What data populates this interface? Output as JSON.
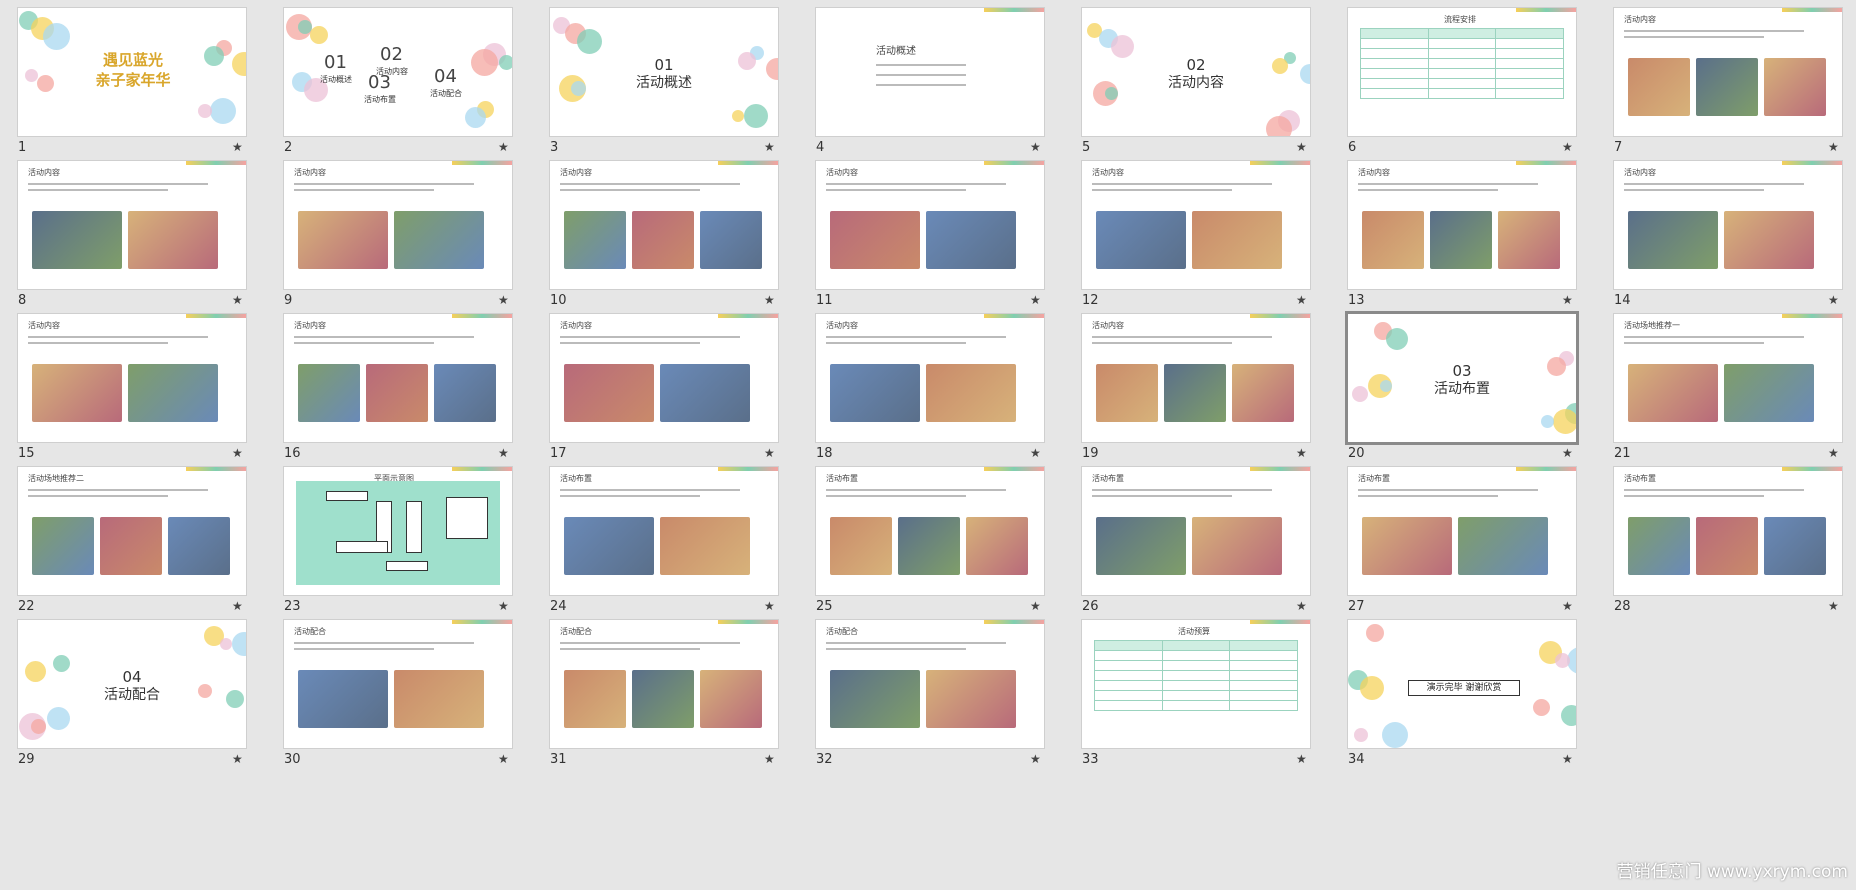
{
  "slides": [
    {
      "num": "1",
      "title": "遇见蓝光\n亲子家年华",
      "kind": "cover"
    },
    {
      "num": "2",
      "kind": "menu",
      "items": [
        {
          "n": "01",
          "l": "活动概述"
        },
        {
          "n": "02",
          "l": "活动内容"
        },
        {
          "n": "03",
          "l": "活动布置"
        },
        {
          "n": "04",
          "l": "活动配合"
        }
      ]
    },
    {
      "num": "3",
      "kind": "section",
      "n": "01",
      "title": "活动概述"
    },
    {
      "num": "4",
      "kind": "text",
      "header": "活动概述"
    },
    {
      "num": "5",
      "kind": "section",
      "n": "02",
      "title": "活动内容"
    },
    {
      "num": "6",
      "kind": "table",
      "header": "流程安排"
    },
    {
      "num": "7",
      "kind": "photos",
      "header": "活动内容"
    },
    {
      "num": "8",
      "kind": "photos",
      "header": "活动内容"
    },
    {
      "num": "9",
      "kind": "photos",
      "header": "活动内容"
    },
    {
      "num": "10",
      "kind": "photos",
      "header": "活动内容"
    },
    {
      "num": "11",
      "kind": "photos",
      "header": "活动内容"
    },
    {
      "num": "12",
      "kind": "photos",
      "header": "活动内容"
    },
    {
      "num": "13",
      "kind": "photos",
      "header": "活动内容"
    },
    {
      "num": "14",
      "kind": "photos",
      "header": "活动内容"
    },
    {
      "num": "15",
      "kind": "photos",
      "header": "活动内容"
    },
    {
      "num": "16",
      "kind": "photos",
      "header": "活动内容"
    },
    {
      "num": "17",
      "kind": "photos",
      "header": "活动内容"
    },
    {
      "num": "18",
      "kind": "photos",
      "header": "活动内容"
    },
    {
      "num": "19",
      "kind": "photos",
      "header": "活动内容"
    },
    {
      "num": "20",
      "kind": "section",
      "n": "03",
      "title": "活动布置",
      "selected": true
    },
    {
      "num": "21",
      "kind": "photos",
      "header": "活动场地推荐一"
    },
    {
      "num": "22",
      "kind": "photos",
      "header": "活动场地推荐二"
    },
    {
      "num": "23",
      "kind": "plan",
      "header": "平面示意图"
    },
    {
      "num": "24",
      "kind": "photos",
      "header": "活动布置"
    },
    {
      "num": "25",
      "kind": "photos",
      "header": "活动布置"
    },
    {
      "num": "26",
      "kind": "photos",
      "header": "活动布置"
    },
    {
      "num": "27",
      "kind": "photos",
      "header": "活动布置"
    },
    {
      "num": "28",
      "kind": "photos",
      "header": "活动布置"
    },
    {
      "num": "29",
      "kind": "section",
      "n": "04",
      "title": "活动配合"
    },
    {
      "num": "30",
      "kind": "photos",
      "header": "活动配合"
    },
    {
      "num": "31",
      "kind": "photos",
      "header": "活动配合"
    },
    {
      "num": "32",
      "kind": "photos",
      "header": "活动配合"
    },
    {
      "num": "33",
      "kind": "table",
      "header": "活动预算"
    },
    {
      "num": "34",
      "kind": "end",
      "title": "演示完毕 谢谢欣赏"
    }
  ],
  "star_glyph": "★",
  "watermark": "营销任意门 www.yxrym.com"
}
